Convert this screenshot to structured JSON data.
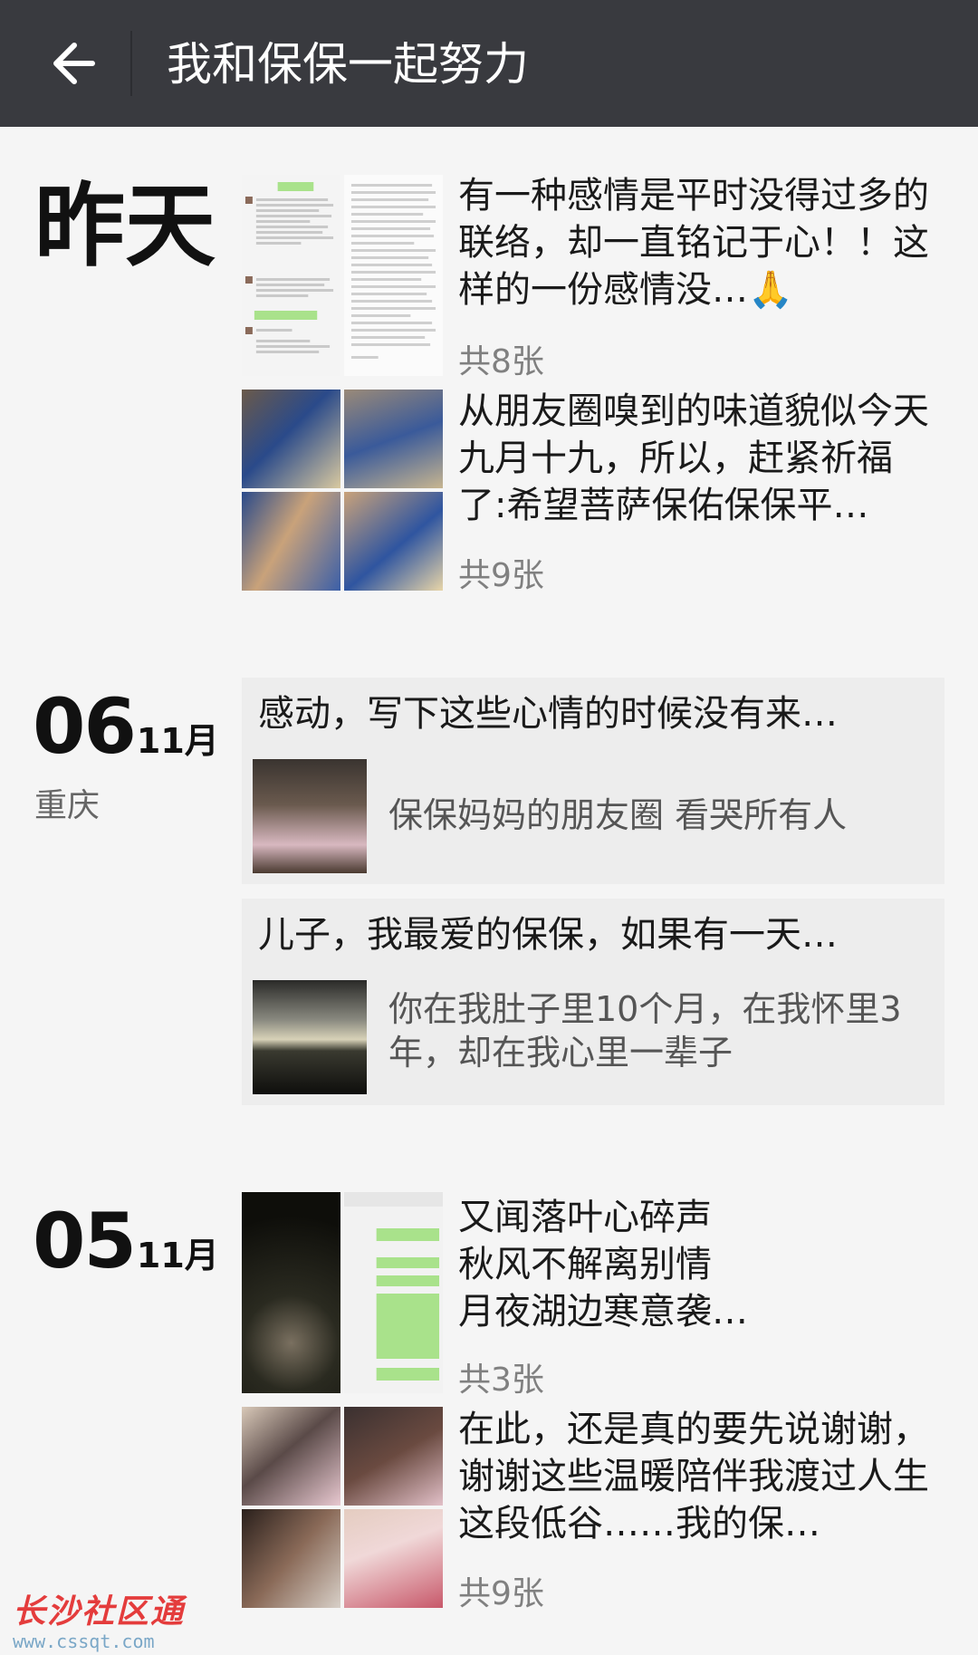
{
  "header": {
    "title": "我和保保一起努力"
  },
  "sections": {
    "yesterday": {
      "label": "昨天",
      "posts": [
        {
          "text": "有一种感情是平时没得过多的联络，却一直铭记于心！！这样的一份感情没…🙏",
          "count": "共8张"
        },
        {
          "text": "从朋友圈嗅到的味道貌似今天九月十九，所以，赶紧祈福了:希望菩萨保佑保保平…",
          "count": "共9张"
        }
      ]
    },
    "d06": {
      "day": "06",
      "month": "11月",
      "place": "重庆",
      "shares": [
        {
          "title": "感动，写下这些心情的时候没有来…",
          "desc": "保保妈妈的朋友圈  看哭所有人"
        },
        {
          "title": "儿子，我最爱的保保，如果有一天…",
          "desc": "你在我肚子里10个月，在我怀里3年，却在我心里一辈子"
        }
      ]
    },
    "d05": {
      "day": "05",
      "month": "11月",
      "posts": [
        {
          "text": "又闻落叶心碎声\n秋风不解离别情\n月夜湖边寒意袭…",
          "count": "共3张"
        },
        {
          "text": "在此，还是真的要先说谢谢，谢谢这些温暖陪伴我渡过人生这段低谷……我的保…",
          "count": "共9张"
        }
      ]
    }
  },
  "watermark": {
    "main": "长沙社区通",
    "url": "www.cssqt.com"
  }
}
